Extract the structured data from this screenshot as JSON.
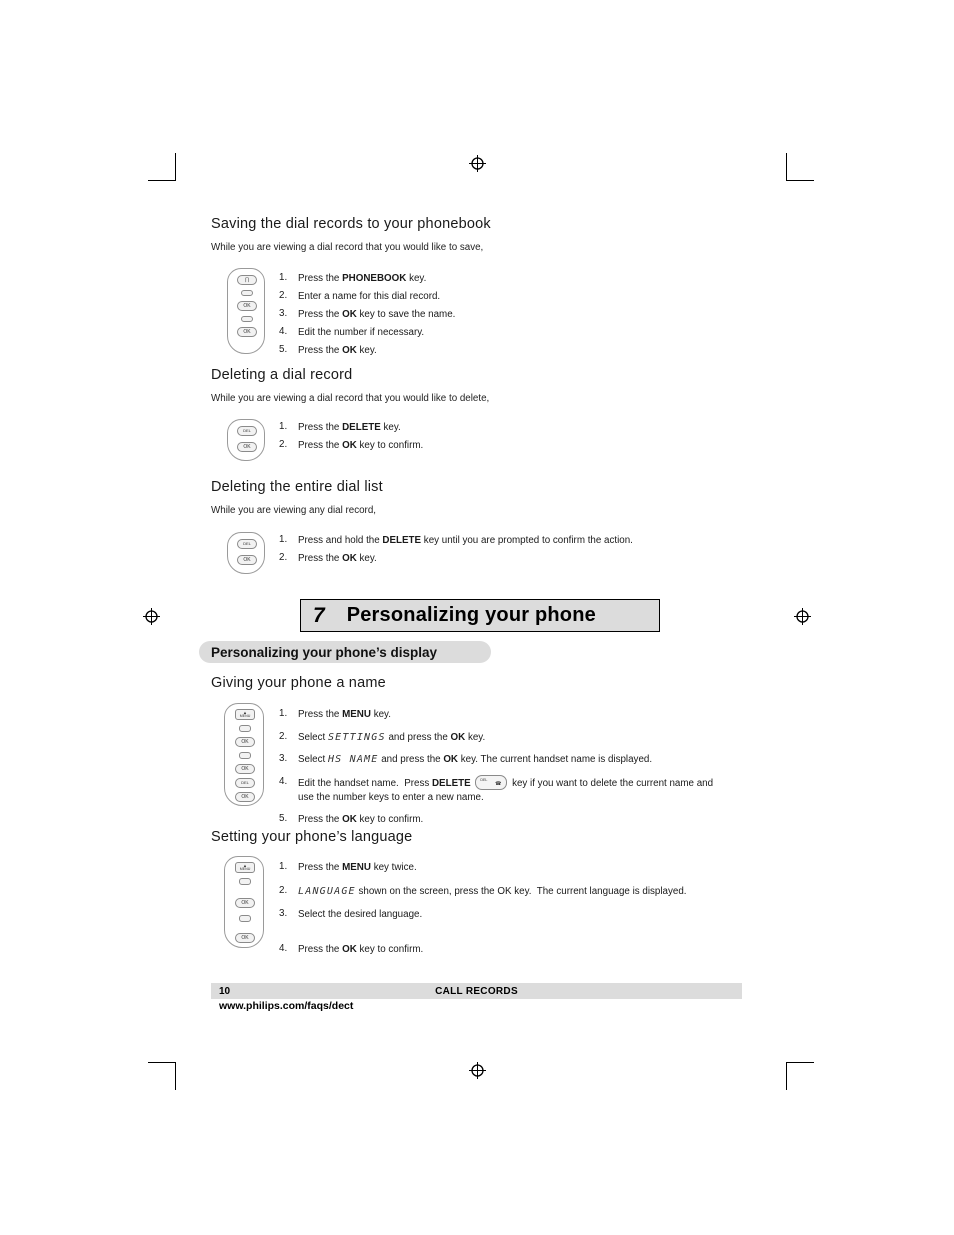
{
  "document": {
    "sections": [
      {
        "heading": "Saving the dial records to your phonebook",
        "intro": "While you are viewing a dial record that you would like to save,",
        "steps": [
          {
            "num": "1.",
            "text": "Press the PHONEBOOK key."
          },
          {
            "num": "2.",
            "text": "Enter a name for this dial record."
          },
          {
            "num": "3.",
            "text": "Press the OK key to save the name."
          },
          {
            "num": "4.",
            "text": "Edit the number if necessary."
          },
          {
            "num": "5.",
            "text": "Press the OK key."
          }
        ]
      },
      {
        "heading": "Deleting a dial record",
        "intro": "While you are viewing a dial record that you would like to delete,",
        "steps": [
          {
            "num": "1.",
            "text": "Press the DELETE key."
          },
          {
            "num": "2.",
            "text": "Press the OK key to confirm."
          }
        ]
      },
      {
        "heading": "Deleting the entire dial list",
        "intro": "While you are viewing any dial record,",
        "steps": [
          {
            "num": "1.",
            "text": "Press and hold the DELETE key until you are prompted to confirm the action."
          },
          {
            "num": "2.",
            "text": "Press the OK key."
          }
        ]
      }
    ]
  },
  "chapter": {
    "number": "7",
    "title": "Personalizing your phone",
    "subbanner": "Personalizing your phone’s display"
  },
  "section_name": {
    "heading": "Giving your phone a name",
    "steps": [
      {
        "num": "1.",
        "text": "Press the MENU key."
      },
      {
        "num": "2.",
        "text": "Select SETTINGS and press the OK key."
      },
      {
        "num": "3.",
        "text": "Select HS NAME and press the OK key. The current handset name is displayed."
      },
      {
        "num": "4.",
        "text": "Edit the handset name. Press DELETE key if you want to delete the current name and use the number keys to enter a new name."
      },
      {
        "num": "5.",
        "text": "Press the OK key to confirm."
      }
    ],
    "lcd_settings": "SETTINGS",
    "lcd_hsname": "HS NAME"
  },
  "section_language": {
    "heading": "Setting your phone’s language",
    "steps": [
      {
        "num": "1.",
        "text": "Press the MENU key twice."
      },
      {
        "num": "2.",
        "text": "LANGUAGE shown on the screen, press the OK key. The current language is displayed."
      },
      {
        "num": "3.",
        "text": "Select the desired language."
      },
      {
        "num": "4.",
        "text": "Press the OK key to confirm."
      }
    ],
    "lcd_language": "LANGUAGE"
  },
  "footer": {
    "page_number": "10",
    "section_label": "CALL RECORDS",
    "website": "www.philips.com/faqs/dect"
  },
  "handsets": {
    "phonebook_keys": {
      "top": "∏",
      "ok1": "OK",
      "ok2": "OK"
    },
    "delete_keys": {
      "del": "DEL",
      "ok": "OK"
    },
    "menu_key": "MENU",
    "ok_key": "OK",
    "del_key": "DEL",
    "inline_delete_key": {
      "label": "DEL"
    }
  },
  "colors": {
    "banner_gray": "#dcdcdc",
    "text": "#000000",
    "rule": "#000000"
  }
}
